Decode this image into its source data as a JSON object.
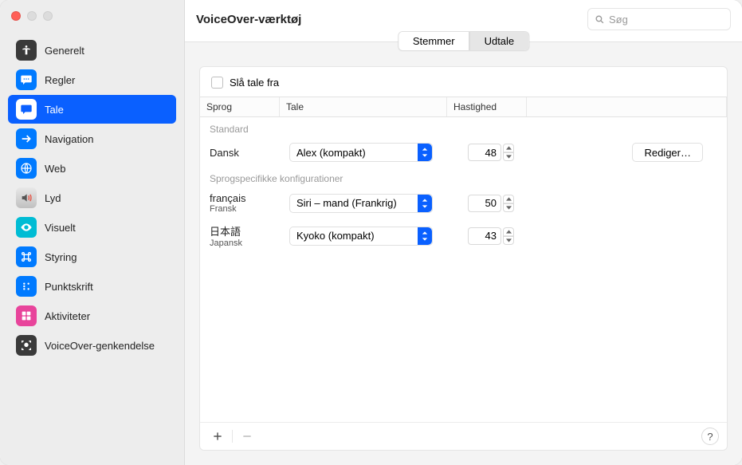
{
  "window": {
    "title": "VoiceOver-værktøj"
  },
  "search": {
    "placeholder": "Søg"
  },
  "sidebar": {
    "items": [
      {
        "label": "Generelt"
      },
      {
        "label": "Regler"
      },
      {
        "label": "Tale"
      },
      {
        "label": "Navigation"
      },
      {
        "label": "Web"
      },
      {
        "label": "Lyd"
      },
      {
        "label": "Visuelt"
      },
      {
        "label": "Styring"
      },
      {
        "label": "Punktskrift"
      },
      {
        "label": "Aktiviteter"
      },
      {
        "label": "VoiceOver-genkendelse"
      }
    ]
  },
  "tabs": {
    "voices": "Stemmer",
    "pronunciation": "Udtale"
  },
  "mute": {
    "label": "Slå tale fra"
  },
  "columns": {
    "language": "Sprog",
    "voice": "Tale",
    "speed": "Hastighed"
  },
  "sections": {
    "default": "Standard",
    "specific": "Sprogspecifikke konfigurationer"
  },
  "rows": {
    "default": {
      "lang": "Dansk",
      "voice": "Alex (kompakt)",
      "speed": "48"
    },
    "french": {
      "lang": "français",
      "sub": "Fransk",
      "voice": "Siri – mand (Frankrig)",
      "speed": "50"
    },
    "japanese": {
      "lang": "日本語",
      "sub": "Japansk",
      "voice": "Kyoko (kompakt)",
      "speed": "43"
    }
  },
  "buttons": {
    "edit": "Rediger…"
  },
  "help": {
    "label": "?"
  }
}
